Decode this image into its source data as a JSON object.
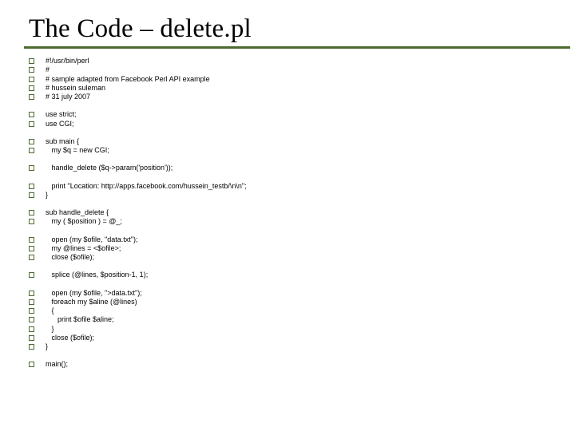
{
  "title": "The Code – delete.pl",
  "groups": [
    [
      "#!/usr/bin/perl",
      "#",
      "# sample adapted from Facebook Perl API example",
      "# hussein suleman",
      "# 31 july 2007"
    ],
    [
      "use strict;",
      "use CGI;"
    ],
    [
      "sub main {",
      "   my $q = new CGI;"
    ],
    [
      "   handle_delete ($q->param('position'));"
    ],
    [
      "   print \"Location: http://apps.facebook.com/hussein_testb/\\n\\n\";",
      "}"
    ],
    [
      "sub handle_delete {",
      "   my ( $position ) = @_;"
    ],
    [
      "   open (my $ofile, \"data.txt\");",
      "   my @lines = <$ofile>;",
      "   close ($ofile);"
    ],
    [
      "   splice (@lines, $position-1, 1);"
    ],
    [
      "   open (my $ofile, \">data.txt\");",
      "   foreach my $aline (@lines)",
      "   {",
      "      print $ofile $aline;",
      "   }",
      "   close ($ofile);",
      "}"
    ],
    [
      "main();"
    ]
  ]
}
